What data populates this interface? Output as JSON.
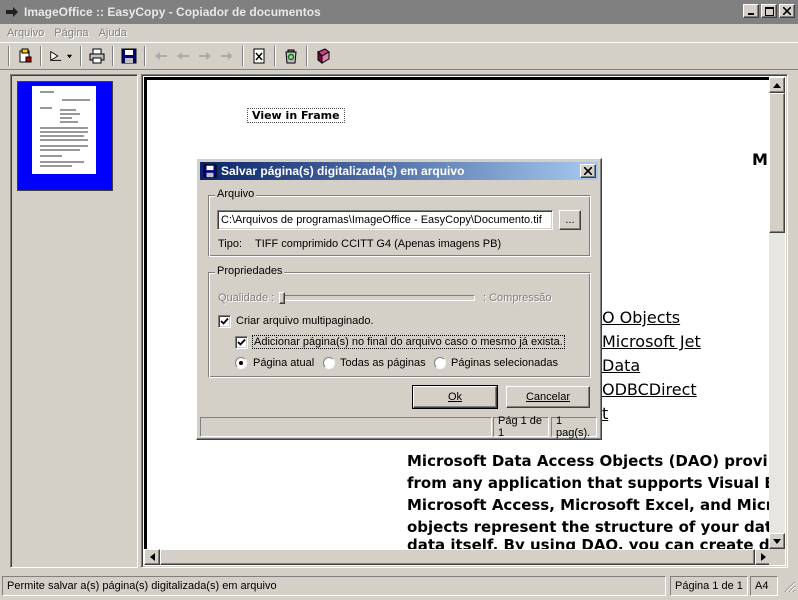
{
  "window": {
    "title": "ImageOffice :: EasyCopy - Copiador de documentos"
  },
  "menu": {
    "items": [
      "Arquivo",
      "Página",
      "Ajuda"
    ]
  },
  "toolbar": {
    "icons": [
      "scan-icon",
      "open-icon",
      "print-icon",
      "save-icon",
      "first-page-icon",
      "prev-page-icon",
      "next-page-icon",
      "last-page-icon",
      "excel-icon",
      "recycle-icon",
      "book-icon"
    ]
  },
  "document": {
    "lines": [
      "View in Frame",
      "MI",
      "O Objects",
      "Microsoft Jet",
      "Data",
      "ODBCDirect",
      "t",
      "Microsoft Data Access Objects (DAO) provi",
      "from any application that supports Visual B",
      "Microsoft Access, Microsoft Excel, and Micr",
      "objects represent the structure of your dat",
      "data itself. By using DAO, you can create d"
    ]
  },
  "status": {
    "message": "Permite salvar a(s) página(s) digitalizada(s) em arquivo",
    "page": "Página 1 de 1",
    "size": "A4"
  },
  "dialog": {
    "title": "Salvar página(s) digitalizada(s) em arquivo",
    "file_group": {
      "label": "Arquivo",
      "path": "C:\\Arquivos de programas\\ImageOffice - EasyCopy\\Documento.tif",
      "browse_label": "...",
      "type_label": "Tipo:",
      "type_value": "TIFF comprimido CCITT G4 (Apenas imagens PB)"
    },
    "props_group": {
      "label": "Propriedades",
      "quality_label": "Qualidade :",
      "compression_label": ": Compressão",
      "multipage_label": "Criar arquivo multipaginado.",
      "multipage_checked": true,
      "append_label": "Adicionar página(s) no final do arquivo caso o mesmo já exista.",
      "append_checked": true,
      "radio_current": "Página atual",
      "radio_all": "Todas as páginas",
      "radio_selected": "Páginas selecionadas",
      "radio_value": "current"
    },
    "ok_label": "Ok",
    "cancel_label": "Cancelar",
    "status_page": "Pág 1 de 1",
    "status_count": "1 pag(s)."
  }
}
